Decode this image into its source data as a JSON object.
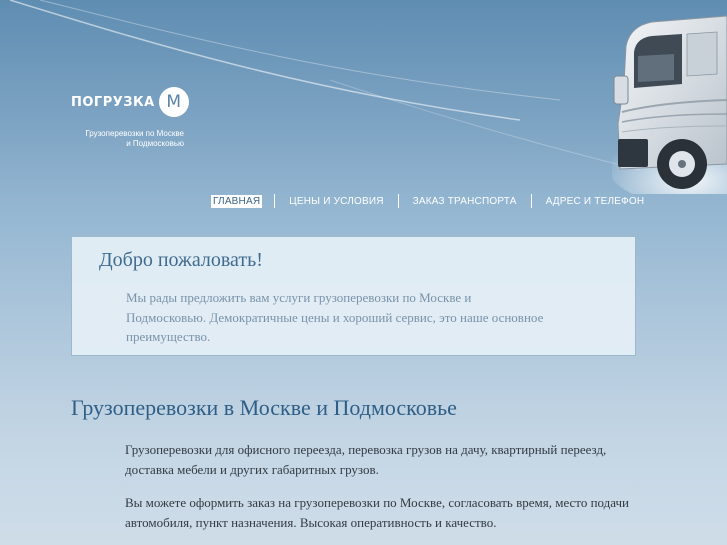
{
  "logo": {
    "word": "ПОГРУЗКА",
    "letter": "М"
  },
  "tagline": {
    "line1": "Грузоперевозки по Москве",
    "line2": "и Подмосковью"
  },
  "nav": {
    "items": [
      {
        "label": "ГЛАВНАЯ"
      },
      {
        "label": "ЦЕНЫ И УСЛОВИЯ"
      },
      {
        "label": "ЗАКАЗ ТРАНСПОРТА"
      },
      {
        "label": "АДРЕС И ТЕЛЕФОН"
      }
    ]
  },
  "welcome": {
    "title": "Добро пожаловать!",
    "text": "Мы рады предложить вам услуги грузоперевозки по Москве и Подмосковью. Демократичные цены и хороший сервис, это наше основное преимущество."
  },
  "main": {
    "title": "Грузоперевозки в Москве и Подмосковье",
    "paragraphs": [
      "Грузоперевозки для офисного переезда, перевозка грузов на дачу, квартирный переезд, доставка мебели и других габаритных грузов.",
      "Вы можете оформить заказ на грузоперевозки по Москве, согласовать время, место подачи автомобиля, пункт назначения. Высокая оперативность и качество."
    ]
  },
  "colors": {
    "accent": "#2f5f86",
    "nav_active_bg": "#ffffff",
    "panel_bg": "#e4eef5"
  },
  "icons": {
    "hero": "truck-icon"
  }
}
